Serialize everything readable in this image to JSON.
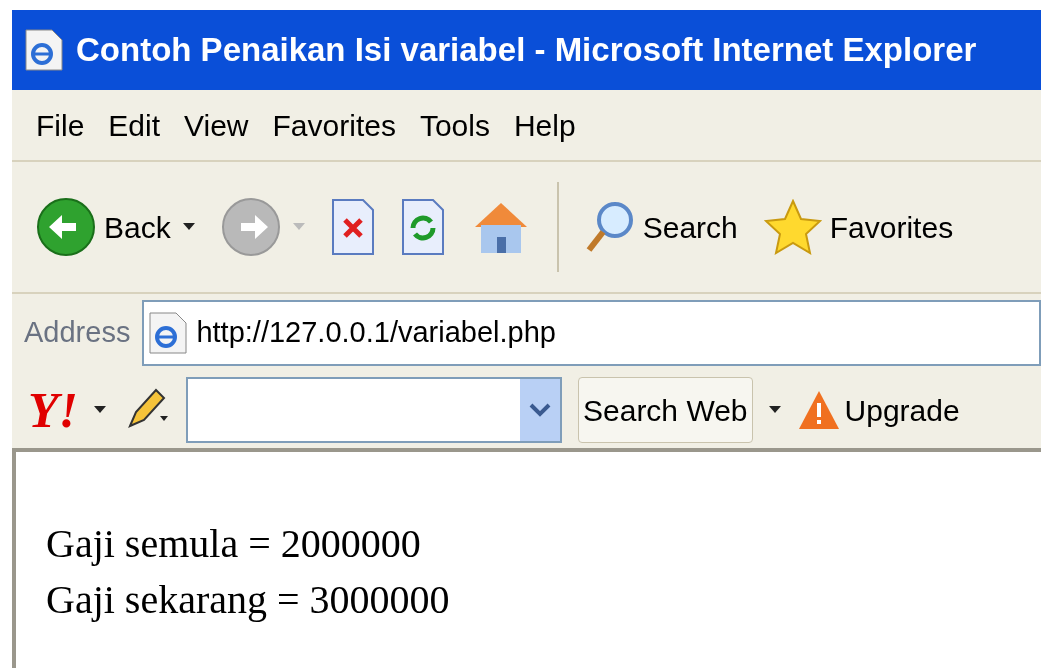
{
  "window": {
    "title": "Contoh Penaikan Isi variabel - Microsoft Internet Explorer"
  },
  "menu": [
    "File",
    "Edit",
    "View",
    "Favorites",
    "Tools",
    "Help"
  ],
  "toolbar": [
    {
      "kind": "back",
      "label": "Back",
      "disabled": false
    },
    {
      "kind": "forward",
      "disabled": true
    },
    {
      "kind": "stop"
    },
    {
      "kind": "refresh"
    },
    {
      "kind": "home"
    },
    {
      "kind": "search",
      "label": "Search"
    },
    {
      "kind": "favorites",
      "label": "Favorites"
    }
  ],
  "address": {
    "label": "Address",
    "value": "http://127.0.0.1/variabel.php"
  },
  "yahoo": {
    "logo": "Y!",
    "search_button": "Search Web",
    "upgrade": "Upgrade"
  },
  "content": [
    "Gaji semula = 2000000",
    "Gaji sekarang = 3000000"
  ]
}
